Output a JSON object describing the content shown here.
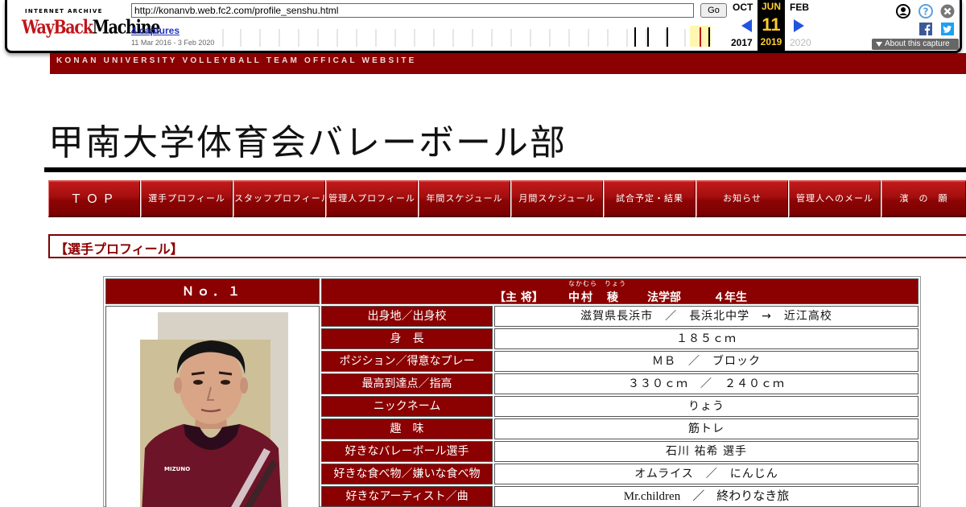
{
  "wayback": {
    "logo_top": "INTERNET ARCHIVE",
    "logo_wayback": "WayBack",
    "logo_machine": "Machine",
    "url": "http://konanvb.web.fc2.com/profile_senshu.html",
    "go_label": "Go",
    "captures_label": "4 captures",
    "range": "11 Mar 2016 - 3 Feb 2020",
    "prev_month": "OCT",
    "prev_year": "2017",
    "cur_month": "JUN",
    "cur_day": "11",
    "cur_year": "2019",
    "next_month": "FEB",
    "next_year": "2020",
    "about_label": "About this capture",
    "icons": [
      "user-icon",
      "help-icon",
      "close-icon",
      "facebook-icon",
      "twitter-icon"
    ]
  },
  "site": {
    "bar_text": "KONAN UNIVERSITY VOLLEYBALL TEAM OFFICAL WEBSITE",
    "title": "甲南大学体育会バレーボール部",
    "nav": [
      "ＴＯＰ",
      "選手プロフィール",
      "スタッフプロフィール",
      "管理人プロフィール",
      "年間スケジュール",
      "月間スケジュール",
      "試合予定・結果",
      "お知らせ",
      "管理人へのメール",
      "濱　の　願"
    ],
    "section_heading": "【選手プロフィール】"
  },
  "profile": {
    "number": "Ｎｏ．１",
    "captain": "【主 将】",
    "name": "中村　稜",
    "name_ruby": "なかむら　りょう",
    "faculty": "法学部",
    "year": "４年生",
    "rows": [
      {
        "label": "出身地／出身校",
        "value": "滋賀県長浜市　／　長浜北中学　→　近江高校"
      },
      {
        "label": "身　長",
        "value": "１８５ｃｍ"
      },
      {
        "label": "ポジション／得意なプレー",
        "value": "ＭＢ　／　ブロック"
      },
      {
        "label": "最高到達点／指高",
        "value": "３３０ｃｍ　／　２４０ｃｍ"
      },
      {
        "label": "ニックネーム",
        "value": "りょう"
      },
      {
        "label": "趣　味",
        "value": "筋トレ"
      },
      {
        "label": "好きなバレーボール選手",
        "value": "石川 祐希 選手"
      },
      {
        "label": "好きな食べ物／嫌いな食べ物",
        "value": "オムライス　／　にんじん"
      },
      {
        "label": "好きなアーティスト／曲",
        "value": "Mr.children　／　終わりなき旅"
      }
    ],
    "colors": {
      "accent": "#8b0000",
      "jersey": "#6e1428"
    }
  }
}
